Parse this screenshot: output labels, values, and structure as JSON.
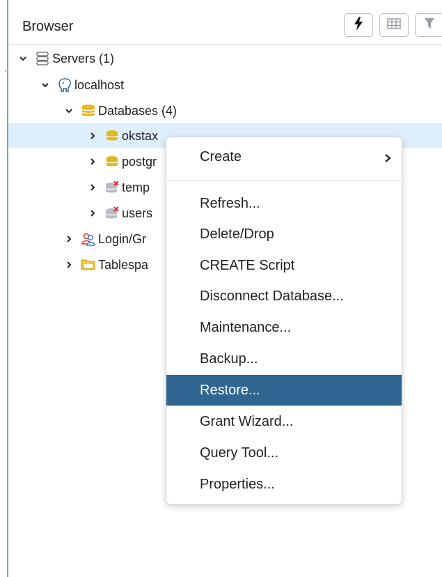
{
  "browser": {
    "title": "Browser",
    "toolbar": {
      "query_icon": "lightning-bolt",
      "view_data_icon": "table-grid",
      "filter_icon": "funnel"
    }
  },
  "tree": {
    "servers": {
      "label": "Servers (1)"
    },
    "localhost": {
      "label": "localhost"
    },
    "databases": {
      "label": "Databases (4)"
    },
    "db_okstax": {
      "label": "okstax"
    },
    "db_postgres": {
      "label": "postgr"
    },
    "db_temp": {
      "label": "temp"
    },
    "db_users": {
      "label": "users"
    },
    "login_groups": {
      "label": "Login/Gr"
    },
    "tablespaces": {
      "label": "Tablespa"
    }
  },
  "context_menu": {
    "items": [
      {
        "label": "Create",
        "has_submenu": true
      },
      {
        "label": "Refresh..."
      },
      {
        "label": "Delete/Drop"
      },
      {
        "label": "CREATE Script"
      },
      {
        "label": "Disconnect Database..."
      },
      {
        "label": "Maintenance..."
      },
      {
        "label": "Backup..."
      },
      {
        "label": "Restore...",
        "highlighted": true
      },
      {
        "label": "Grant Wizard..."
      },
      {
        "label": "Query Tool..."
      },
      {
        "label": "Properties..."
      }
    ]
  },
  "colors": {
    "selected_row": "#dfeefb",
    "menu_highlight": "#2f6591",
    "db_gold": "#e2b722",
    "disconnected_red": "#d9343a"
  }
}
